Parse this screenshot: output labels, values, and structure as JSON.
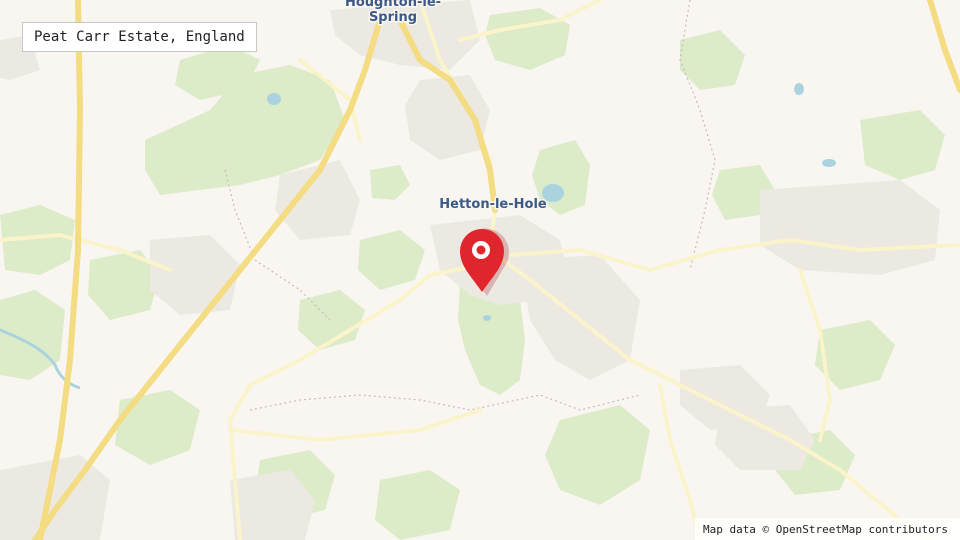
{
  "map": {
    "title": "Peat Carr Estate, England",
    "attribution": "Map data © OpenStreetMap contributors",
    "places": {
      "houghton_line1": "Houghton-le-",
      "houghton_line2": "Spring",
      "hetton": "Hetton-le-Hole"
    },
    "marker": {
      "icon": "map-pin-icon",
      "color": "#e0262d"
    },
    "colors": {
      "background": "#f9f6f1",
      "woodland": "#dcebc8",
      "water": "#aad3df",
      "urban": "#ece9e3",
      "motorway": "#f3dc81",
      "road": "#fbf3c9"
    }
  }
}
